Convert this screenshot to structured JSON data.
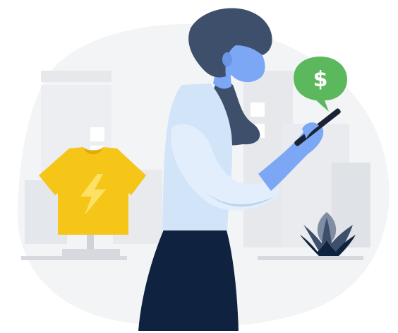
{
  "illustration": {
    "speech_bubble": {
      "symbol": "$",
      "color": "#5cb85c"
    },
    "colors": {
      "blob_background": "#f3f4f6",
      "building_light": "#e6e8ec",
      "building_mid": "#dcdfe4",
      "shelf": "#d6d9de",
      "tshirt": "#f5c518",
      "tshirt_bolt": "#ffe066",
      "stand": "#d6d9de",
      "skin": "#7ba7f5",
      "hair": "#3d4f6b",
      "shirt": "#d2e4f8",
      "shirt_shade": "#b9d3f2",
      "skirt": "#0f2340",
      "phone": "#1a2233",
      "plant_dark": "#0f2340",
      "plant_mid": "#3d4f6b",
      "plant_light": "#7f8da3"
    },
    "icons": [
      "tshirt-icon",
      "lightning-icon",
      "dollar-icon",
      "plant-icon",
      "phone-icon"
    ]
  }
}
